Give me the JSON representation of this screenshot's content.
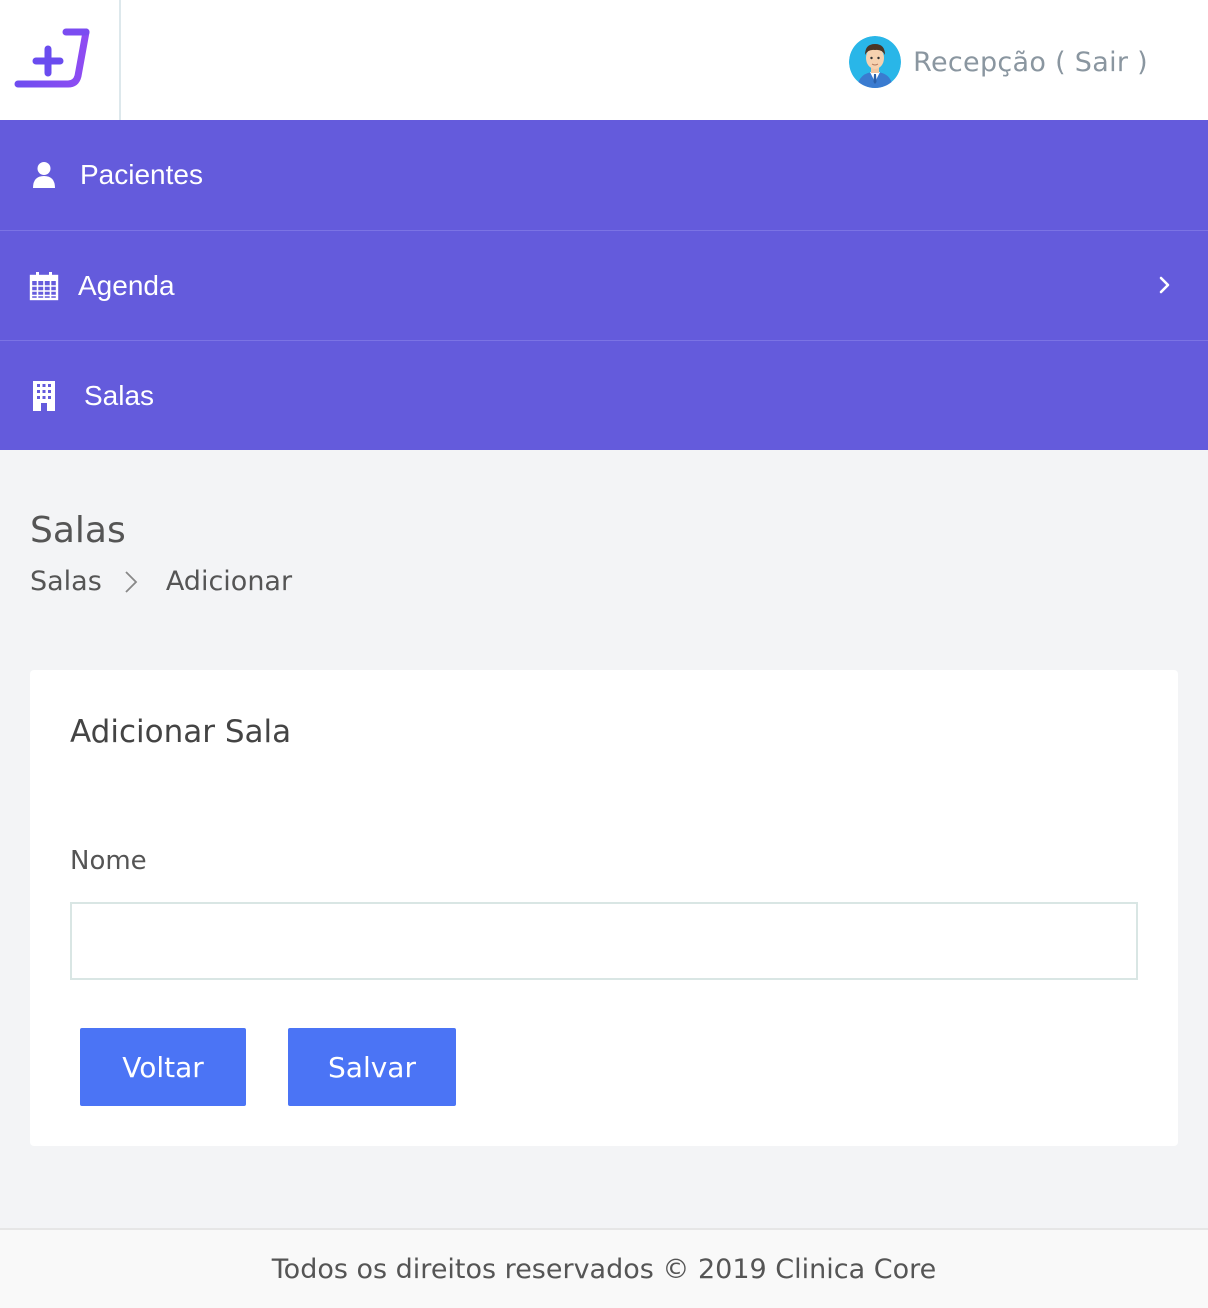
{
  "header": {
    "user_label": "Recepção ( Sair )",
    "logo_icon": "plus-bracket-logo",
    "avatar_icon": "user-avatar"
  },
  "nav": {
    "background": "#645bdc",
    "items": [
      {
        "label": "Pacientes",
        "icon": "user-icon"
      },
      {
        "label": "Agenda",
        "icon": "calendar-icon",
        "has_submenu": true
      },
      {
        "label": "Salas",
        "icon": "building-icon"
      }
    ]
  },
  "page": {
    "title": "Salas",
    "breadcrumb": [
      "Salas",
      "Adicionar"
    ]
  },
  "form": {
    "title": "Adicionar Sala",
    "name_label": "Nome",
    "name_value": "",
    "back_label": "Voltar",
    "save_label": "Salvar",
    "button_color": "#4b74f5"
  },
  "footer": {
    "text": "Todos os direitos reservados © 2019 Clinica Core"
  }
}
